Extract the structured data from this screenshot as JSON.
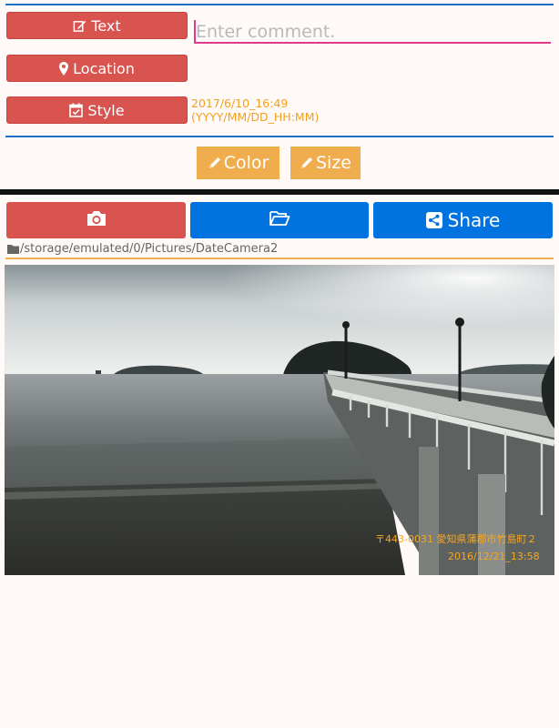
{
  "form": {
    "text_button": "Text",
    "location_button": "Location",
    "style_button": "Style",
    "comment_placeholder": "Enter comment.",
    "style_date": "2017/6/10_16:49",
    "style_format": "(YYYY/MM/DD_HH:MM)"
  },
  "options": {
    "color_button": "Color",
    "size_button": "Size"
  },
  "toolbar": {
    "share_button": "Share"
  },
  "path": "/storage/emulated/0/Pictures/DateCamera2",
  "photo": {
    "address_stamp": "〒443-0031 愛知県蒲郡市竹島町２",
    "date_stamp": "2016/12/21_13:58"
  },
  "colors": {
    "red": "#d9534f",
    "blue": "#0073e0",
    "orange": "#f0ad4e",
    "accent_pink": "#e03a86",
    "divider_blue": "#1f6fc4"
  }
}
